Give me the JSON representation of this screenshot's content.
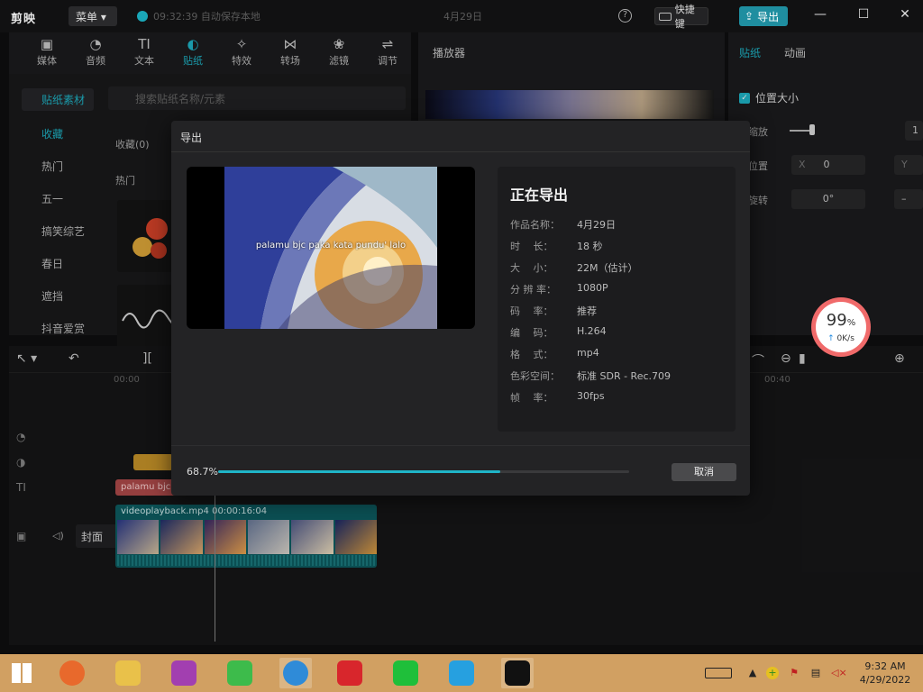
{
  "app": {
    "logo": "剪映",
    "menu_label": "菜单",
    "save_status": "09:32:39 自动保存本地",
    "project_name": "4月29日",
    "help": "?",
    "shortcut_label": "快捷键",
    "export_label": "导出",
    "min": "—",
    "max": "☐",
    "close": "✕"
  },
  "tool_tabs": [
    {
      "label": "媒体",
      "icon": "media-icon",
      "glyph": "▣"
    },
    {
      "label": "音频",
      "icon": "audio-icon",
      "glyph": "◔"
    },
    {
      "label": "文本",
      "icon": "text-icon",
      "glyph": "TI"
    },
    {
      "label": "贴纸",
      "icon": "sticker-icon",
      "glyph": "◐"
    },
    {
      "label": "特效",
      "icon": "effects-icon",
      "glyph": "✧"
    },
    {
      "label": "转场",
      "icon": "transition-icon",
      "glyph": "⋈"
    },
    {
      "label": "滤镜",
      "icon": "filter-icon",
      "glyph": "❀"
    },
    {
      "label": "调节",
      "icon": "adjust-icon",
      "glyph": "⇌"
    }
  ],
  "left_panel": {
    "categories": [
      "贴纸素材",
      "收藏",
      "热门",
      "五一",
      "搞笑综艺",
      "春日",
      "遮挡",
      "抖音爱赏"
    ],
    "search_placeholder": "搜索贴纸名称/元素",
    "fav_label": "收藏(0)",
    "hot_label": "热门"
  },
  "player": {
    "title": "播放器"
  },
  "right_panel": {
    "tabs": [
      "贴纸",
      "动画"
    ],
    "section": "位置大小",
    "rows": [
      "缩放",
      "位置",
      "旋转"
    ],
    "x_label": "X",
    "x_value": "0",
    "y_label": "Y",
    "rotate_value": "0°",
    "scale_value": "1"
  },
  "timeline": {
    "ruler": [
      "00:00",
      "00:40"
    ],
    "text_clip": "palamu bjc",
    "video_clip": "videoplayback.mp4",
    "video_duration": "00:00:16:04",
    "cover_label": "封面"
  },
  "export_dialog": {
    "title": "导出",
    "status": "正在导出",
    "preview_caption": "palamu bjc paka kata pundu' lalo",
    "info": [
      {
        "k": "作品名称：",
        "v": "4月29日"
      },
      {
        "k": "时　 长：",
        "v": "18 秒"
      },
      {
        "k": "大　 小：",
        "v": "22M（估计）"
      },
      {
        "k": "分 辨 率：",
        "v": "1080P"
      },
      {
        "k": "码　 率：",
        "v": "推荐"
      },
      {
        "k": "编　 码：",
        "v": "H.264"
      },
      {
        "k": "格　 式：",
        "v": "mp4"
      },
      {
        "k": "色彩空间：",
        "v": "标准 SDR - Rec.709"
      },
      {
        "k": "帧　 率：",
        "v": "30fps"
      }
    ],
    "progress_text": "68.7%",
    "progress_value": 68.7,
    "cancel_label": "取消"
  },
  "net_widget": {
    "percent": "99",
    "percent_sign": "%",
    "speed": "0K/s"
  },
  "taskbar": {
    "apps": [
      {
        "name": "windows-start-icon",
        "color": "#1a1a1a"
      },
      {
        "name": "firefox-icon",
        "color": "#e8692c"
      },
      {
        "name": "file-explorer-icon",
        "color": "#e9c14a"
      },
      {
        "name": "media-app-icon",
        "color": "#a23fb0"
      },
      {
        "name": "sync-app-icon",
        "color": "#3dbb4b"
      },
      {
        "name": "chrome-icon",
        "color": "#2f8bd8"
      },
      {
        "name": "netease-music-icon",
        "color": "#d8262c"
      },
      {
        "name": "iqiyi-icon",
        "color": "#1fbf3a"
      },
      {
        "name": "video-player-icon",
        "color": "#26a0e0"
      },
      {
        "name": "capcut-icon",
        "color": "#111111"
      }
    ],
    "time": "9:32 AM",
    "date": "4/29/2022"
  },
  "colors": {
    "accent": "#1fb5c8",
    "taskbar": "#d1a062",
    "net_ring": "#f06a6a"
  }
}
